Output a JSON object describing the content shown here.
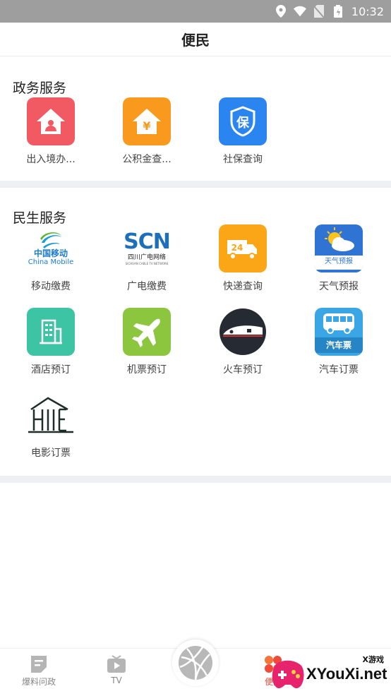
{
  "status_bar": {
    "time": "10:32"
  },
  "header": {
    "title": "便民"
  },
  "sections": [
    {
      "title": "政务服务",
      "items": [
        {
          "label": "出入境办...",
          "icon": "house-person-icon",
          "color": "#f25a63"
        },
        {
          "label": "公积金查...",
          "icon": "house-yen-icon",
          "color": "#f99a1f"
        },
        {
          "label": "社保查询",
          "icon": "shield-bao-icon",
          "color": "#2b85f1"
        }
      ]
    },
    {
      "title": "民生服务",
      "items": [
        {
          "label": "移动缴费",
          "icon": "china-mobile-logo",
          "logo_text": [
            "中国移动",
            "China Mobile"
          ]
        },
        {
          "label": "广电缴费",
          "icon": "scn-logo",
          "logo_text": [
            "SCN",
            "四川广电网络",
            "SICHUAN CABLE TV NETWORK"
          ]
        },
        {
          "label": "快递查询",
          "icon": "delivery-truck-icon",
          "color": "#fba617",
          "logo_text": [
            "24"
          ]
        },
        {
          "label": "天气预报",
          "icon": "weather-sun-cloud-icon",
          "color": "#2f74d3",
          "logo_text": [
            "天气预报"
          ]
        },
        {
          "label": "酒店预订",
          "icon": "hotel-building-icon",
          "color": "#3cc4a5"
        },
        {
          "label": "机票预订",
          "icon": "airplane-icon",
          "color": "#8cc63f"
        },
        {
          "label": "火车预订",
          "icon": "train-icon",
          "color": "#262a33"
        },
        {
          "label": "汽车订票",
          "icon": "bus-icon",
          "color": "#3aa6e6",
          "logo_text": [
            "汽车票"
          ]
        },
        {
          "label": "电影订票",
          "icon": "cinema-building-icon",
          "color": "#1f2d28",
          "logo_text": [
            "H",
            "E"
          ]
        }
      ]
    }
  ],
  "bottom_nav": {
    "items": [
      {
        "label": "爆料问政",
        "icon": "report-icon"
      },
      {
        "label": "TV",
        "icon": "tv-play-icon"
      },
      {
        "label": "",
        "icon": "basketball-icon"
      },
      {
        "label": "便民",
        "icon": "convenience-icon",
        "active_color": "#f04a3a"
      }
    ]
  },
  "watermark": {
    "brand": "XYouXi.net",
    "tag": "X游戏"
  }
}
